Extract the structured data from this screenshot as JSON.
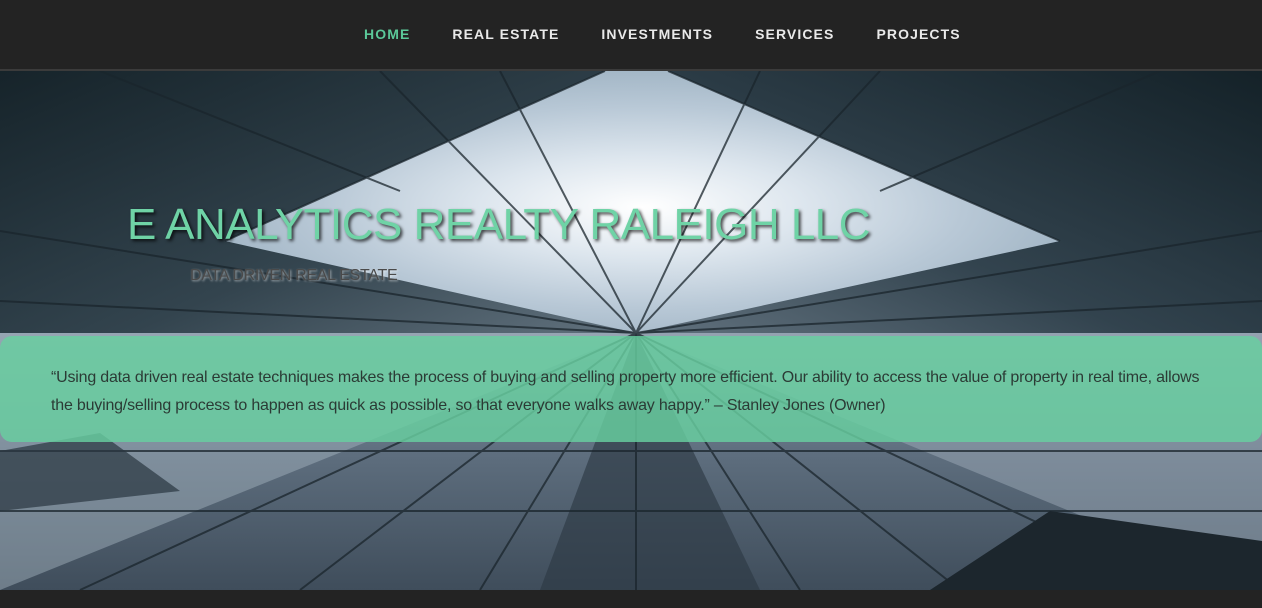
{
  "nav": {
    "items": [
      {
        "label": "HOME",
        "active": true
      },
      {
        "label": "REAL ESTATE",
        "active": false
      },
      {
        "label": "INVESTMENTS",
        "active": false
      },
      {
        "label": "SERVICES",
        "active": false
      },
      {
        "label": "PROJECTS",
        "active": false
      }
    ]
  },
  "hero": {
    "title": "E ANALYTICS REALTY RALEIGH LLC",
    "subtitle": "DATA DRIVEN REAL ESTATE",
    "quote": "“Using data driven real estate techniques makes the process of buying and selling property more efficient. Our ability to access the value of property in real time, allows the buying/selling process to happen as quick as possible, so that everyone walks away happy.” – Stanley Jones (Owner)"
  },
  "colors": {
    "accent": "#5bc899",
    "nav_background": "#232323",
    "band": "#68d0a0"
  }
}
